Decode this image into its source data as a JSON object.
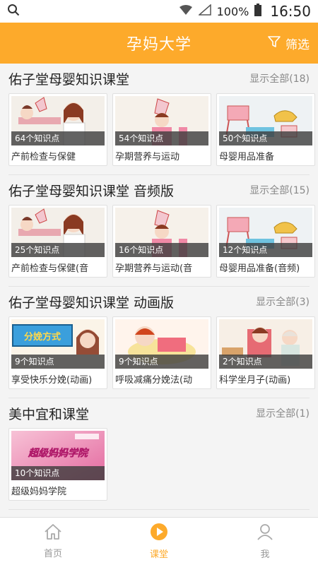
{
  "status": {
    "battery": "100%",
    "time": "16:50"
  },
  "header": {
    "title": "孕妈大学",
    "filter_label": "筛选"
  },
  "sections": [
    {
      "title": "佑子堂母婴知识课堂",
      "more": "显示全部(18)",
      "cards": [
        {
          "count": "64个知识点",
          "label": "产前检查与保健"
        },
        {
          "count": "54个知识点",
          "label": "孕期营养与运动"
        },
        {
          "count": "50个知识点",
          "label": "母婴用品准备"
        }
      ]
    },
    {
      "title": "佑子堂母婴知识课堂 音频版",
      "more": "显示全部(15)",
      "cards": [
        {
          "count": "25个知识点",
          "label": "产前检查与保健(音"
        },
        {
          "count": "16个知识点",
          "label": "孕期营养与运动(音"
        },
        {
          "count": "12个知识点",
          "label": "母婴用品准备(音频)"
        }
      ]
    },
    {
      "title": "佑子堂母婴知识课堂 动画版",
      "more": "显示全部(3)",
      "cards": [
        {
          "count": "9个知识点",
          "label": "享受快乐分娩(动画)",
          "thumb_text": "分娩方式"
        },
        {
          "count": "9个知识点",
          "label": "呼吸减痛分娩法(动"
        },
        {
          "count": "2个知识点",
          "label": "科学坐月子(动画)"
        }
      ]
    },
    {
      "title": "美中宜和课堂",
      "more": "显示全部(1)",
      "cards": [
        {
          "count": "10个知识点",
          "label": "超级妈妈学院",
          "thumb_text": "超级妈妈学院"
        }
      ]
    }
  ],
  "nav": [
    {
      "label": "首页",
      "icon": "home-icon"
    },
    {
      "label": "课堂",
      "icon": "play-icon"
    },
    {
      "label": "我",
      "icon": "user-icon"
    }
  ],
  "colors": {
    "accent": "#fdaa2b"
  }
}
